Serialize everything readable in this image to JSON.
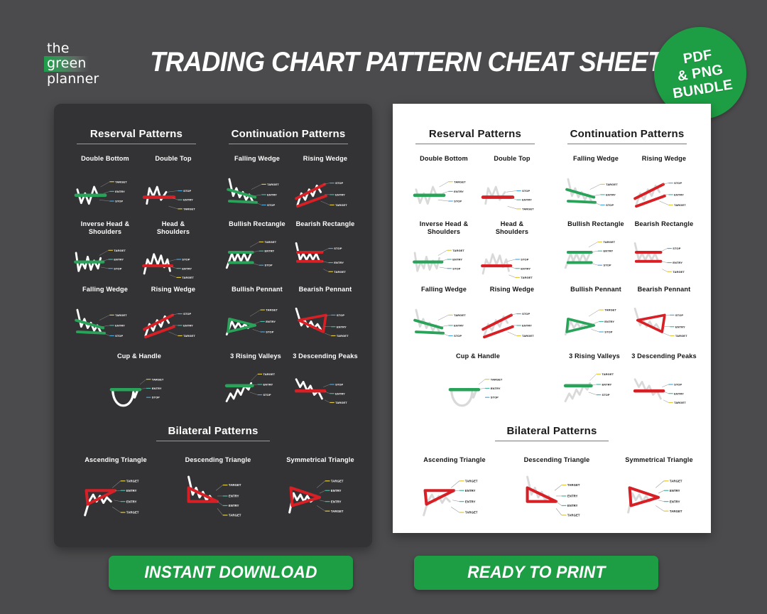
{
  "header": {
    "logo": {
      "line1": "the",
      "line2": "green",
      "line3": "planner"
    },
    "title": "TRADING CHART PATTERN CHEAT SHEET",
    "badge": {
      "line1": "PDF",
      "line2": "& PNG",
      "line3": "BUNDLE"
    }
  },
  "colors": {
    "page_background": "#4b4b4d",
    "dark_sheet": "#333335",
    "light_sheet": "#ffffff",
    "green": "#2aa25a",
    "red": "#d72026",
    "target_label_line": "#e0c93c",
    "entry_label_line": "#4bb6a6",
    "stop_label_line": "#4aa8e0",
    "price_line_dark": "#ffffff",
    "price_line_light": "#d9d9d9",
    "cta_green": "#1d9e44",
    "badge_green": "#1d9e44"
  },
  "sections": [
    {
      "id": "reversal",
      "title": "Reserval Patterns"
    },
    {
      "id": "continuation",
      "title": "Continuation Patterns"
    },
    {
      "id": "bilateral",
      "title": "Bilateral Patterns"
    }
  ],
  "labels": {
    "target": "TARGET",
    "entry": "ENTRY",
    "stop": "STOP"
  },
  "patterns": {
    "reversal": [
      {
        "name": "Double Bottom",
        "shape": "double-bottom",
        "bias": "bullish",
        "annotations": [
          "TARGET",
          "ENTRY",
          "STOP"
        ]
      },
      {
        "name": "Double Top",
        "shape": "double-top",
        "bias": "bearish",
        "annotations": [
          "STOP",
          "ENTRY",
          "TARGET"
        ]
      },
      {
        "name": "Inverse Head & Shoulders",
        "shape": "inverse-hns",
        "bias": "bullish",
        "annotations": [
          "TARGET",
          "ENTRY",
          "STOP"
        ]
      },
      {
        "name": "Head & Shoulders",
        "shape": "hns",
        "bias": "bearish",
        "annotations": [
          "STOP",
          "ENTRY",
          "TARGET"
        ]
      },
      {
        "name": "Falling Wedge",
        "shape": "falling-wedge",
        "bias": "bullish",
        "annotations": [
          "TARGET",
          "ENTRY",
          "STOP"
        ]
      },
      {
        "name": "Rising Wedge",
        "shape": "rising-wedge",
        "bias": "bearish",
        "annotations": [
          "STOP",
          "ENTRY",
          "TARGET"
        ]
      },
      {
        "name": "Cup & Handle",
        "shape": "cup-handle",
        "bias": "bullish",
        "annotations": [
          "TARGET",
          "ENTRY",
          "STOP"
        ]
      }
    ],
    "continuation": [
      {
        "name": "Falling Wedge",
        "shape": "falling-wedge-c",
        "bias": "bullish",
        "annotations": [
          "TARGET",
          "ENTRY",
          "STOP"
        ]
      },
      {
        "name": "Rising Wedge",
        "shape": "rising-wedge-c",
        "bias": "bearish",
        "annotations": [
          "STOP",
          "ENTRY",
          "TARGET"
        ]
      },
      {
        "name": "Bullish Rectangle",
        "shape": "bull-rect",
        "bias": "bullish",
        "annotations": [
          "TARGET",
          "ENTRY",
          "STOP"
        ]
      },
      {
        "name": "Bearish Rectangle",
        "shape": "bear-rect",
        "bias": "bearish",
        "annotations": [
          "STOP",
          "ENTRY",
          "TARGET"
        ]
      },
      {
        "name": "Bullish Pennant",
        "shape": "bull-pennant",
        "bias": "bullish",
        "annotations": [
          "TARGET",
          "ENTRY",
          "STOP"
        ]
      },
      {
        "name": "Bearish Pennant",
        "shape": "bear-pennant",
        "bias": "bearish",
        "annotations": [
          "STOP",
          "ENTRY",
          "TARGET"
        ]
      },
      {
        "name": "3 Rising Valleys",
        "shape": "rising-valleys",
        "bias": "bullish",
        "annotations": [
          "TARGET",
          "ENTRY",
          "STOP"
        ]
      },
      {
        "name": "3 Descending Peaks",
        "shape": "descending-peaks",
        "bias": "bearish",
        "annotations": [
          "STOP",
          "ENTRY",
          "TARGET"
        ]
      }
    ],
    "bilateral": [
      {
        "name": "Ascending Triangle",
        "shape": "asc-triangle",
        "bias": "neutral",
        "annotations": [
          "TARGET",
          "ENTRY",
          "ENTRY",
          "TARGET"
        ]
      },
      {
        "name": "Descending Triangle",
        "shape": "desc-triangle",
        "bias": "neutral",
        "annotations": [
          "TARGET",
          "ENTRY",
          "ENTRY",
          "TARGET"
        ]
      },
      {
        "name": "Symmetrical Triangle",
        "shape": "sym-triangle",
        "bias": "neutral",
        "annotations": [
          "TARGET",
          "ENTRY",
          "ENTRY",
          "TARGET"
        ]
      }
    ]
  },
  "cta": {
    "download": "INSTANT DOWNLOAD",
    "print": "READY TO PRINT"
  }
}
